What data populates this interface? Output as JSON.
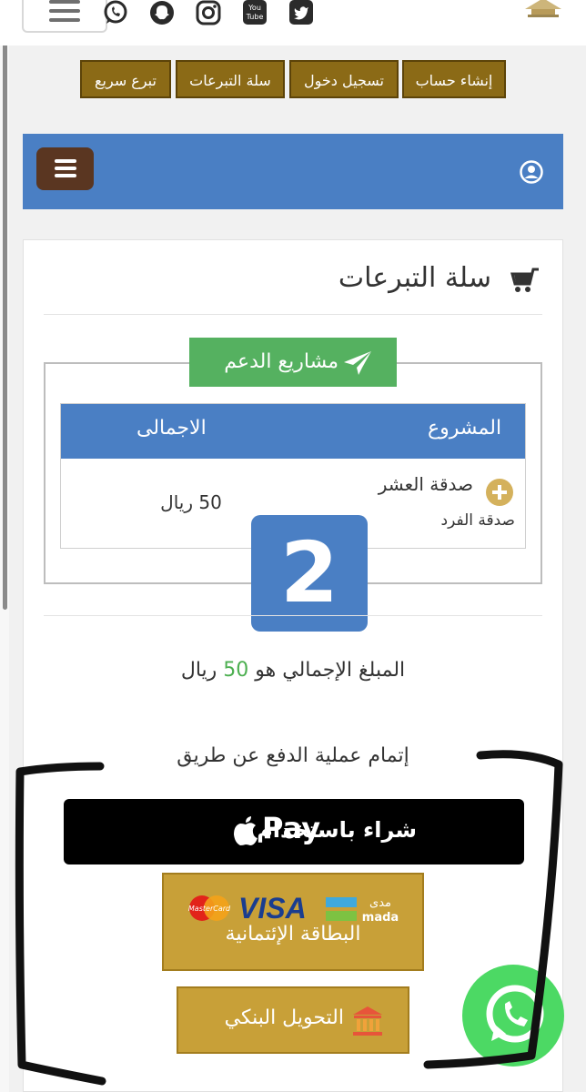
{
  "topnav": {
    "buttons": [
      "إنشاء حساب",
      "تسجيل دخول",
      "سلة التبرعات",
      "تبرع سريع"
    ]
  },
  "social_icons": [
    "whatsapp-icon",
    "snapchat-icon",
    "instagram-icon",
    "youtube-icon",
    "twitter-icon"
  ],
  "youtube_text": [
    "You",
    "Tube"
  ],
  "page": {
    "title": "سلة التبرعات",
    "section_label": "مشاريع الدعم"
  },
  "table": {
    "headers": {
      "project": "المشروع",
      "total": "الاجمالى"
    },
    "rows": [
      {
        "project": "صدقة العشر",
        "sub": "صدقة الفرد",
        "total": "50 ريال"
      }
    ]
  },
  "overlay_number": "2",
  "summary": {
    "prefix": "المبلغ الإجمالي هو",
    "amount": "50",
    "suffix": "ريال"
  },
  "payment": {
    "heading": "إتمام عملية الدفع عن طريق",
    "apple_pay_label": "شراء باستخدام",
    "apple_pay_brand": "Pay",
    "card_label": "البطاقة الإئتمانية",
    "card_brands": {
      "visa": "VISA",
      "mastercard": "MasterCard",
      "mada_ar": "مدى",
      "mada_en": "mada"
    },
    "bank_label": "التحويل البنكي"
  },
  "colors": {
    "brown_nav": "#8b6a16",
    "blue_bar": "#4a7fc4",
    "green": "#55b160",
    "gold": "#c8a038",
    "whatsapp": "#4cd964"
  }
}
